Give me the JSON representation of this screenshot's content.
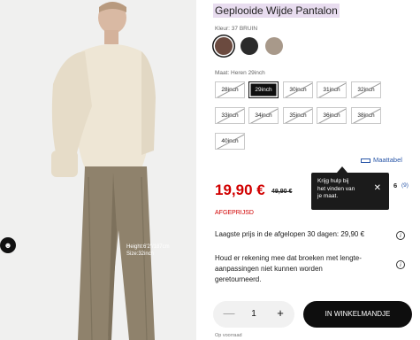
{
  "product": {
    "title": "Geplooide Wijde Pantalon",
    "color_label": "Kleur: 37 BRUIN",
    "colors": [
      {
        "name": "BRUIN",
        "hex": "#6b4a3f",
        "selected": true
      },
      {
        "name": "ZWART",
        "hex": "#2b2b2b",
        "selected": false
      },
      {
        "name": "BEIGE",
        "hex": "#a8998a",
        "selected": false
      }
    ],
    "size_label": "Maat: Heren 29inch",
    "sizes": [
      {
        "label": "28inch",
        "available": false,
        "selected": false
      },
      {
        "label": "29inch",
        "available": true,
        "selected": true
      },
      {
        "label": "30inch",
        "available": false,
        "selected": false
      },
      {
        "label": "31inch",
        "available": false,
        "selected": false
      },
      {
        "label": "32inch",
        "available": false,
        "selected": false
      },
      {
        "label": "33inch",
        "available": false,
        "selected": false
      },
      {
        "label": "34inch",
        "available": false,
        "selected": false
      },
      {
        "label": "35inch",
        "available": false,
        "selected": false
      },
      {
        "label": "36inch",
        "available": false,
        "selected": false
      },
      {
        "label": "38inch",
        "available": false,
        "selected": false
      },
      {
        "label": "40inch",
        "available": false,
        "selected": false
      }
    ],
    "size_chart_link": "Maattabel",
    "price": "19,90 €",
    "old_price": "49,90 €",
    "sale_tag": "AFGEPRIJSD",
    "rating": {
      "value": "6",
      "count": "(9)"
    },
    "lowest_price_note": "Laagste prijs in de afgelopen 30 dagen: 29,90 €",
    "alteration_note": [
      "Houd er rekening mee dat broeken met lengte-",
      "aanpassingen niet kunnen worden",
      "geretourneerd."
    ],
    "quantity": "1",
    "add_to_cart": "IN WINKELMANDJE",
    "stock_note": "Op voorraad"
  },
  "tooltip": {
    "lines": [
      "Krijg hulp bij",
      "het vinden van",
      "je maat."
    ]
  },
  "image": {
    "caption_lines": [
      "Height:6'2\"/187cm",
      "Size:32inch"
    ]
  },
  "icons": {
    "info": "info-icon",
    "close": "close-icon",
    "ruler": "ruler-icon",
    "user": "user-icon",
    "minus": "minus-icon",
    "plus": "plus-icon"
  }
}
